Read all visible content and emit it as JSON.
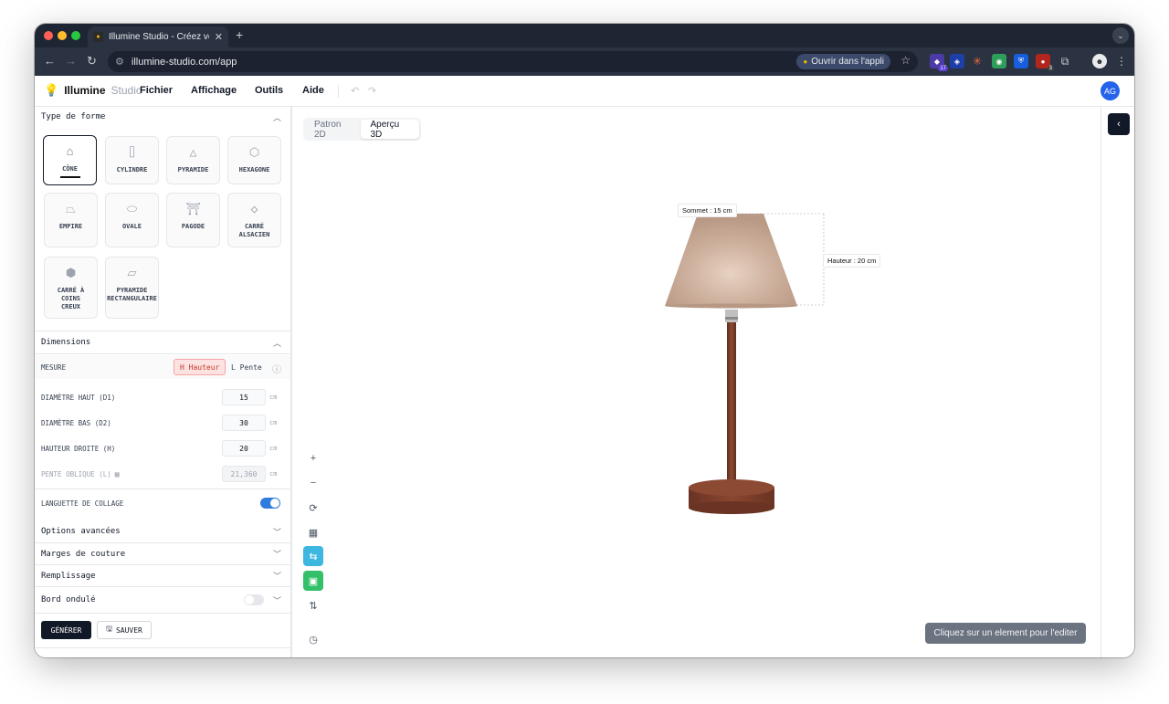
{
  "browser": {
    "tab_title": "Illumine Studio - Créez vos abat-jours",
    "url": "illumine-studio.com/app",
    "open_in_app": "Ouvrir dans l'appli",
    "extension_badges": [
      "17",
      "3"
    ]
  },
  "header": {
    "brand": "Illumine",
    "brand_suffix": "Studio",
    "menus": [
      "Fichier",
      "Affichage",
      "Outils",
      "Aide"
    ],
    "avatar": "AG"
  },
  "shape_section": {
    "title": "Type de forme",
    "shapes": [
      {
        "label": "CÔNE",
        "selected": true
      },
      {
        "label": "CYLINDRE",
        "selected": false
      },
      {
        "label": "PYRAMIDE",
        "selected": false
      },
      {
        "label": "HEXAGONE",
        "selected": false
      },
      {
        "label": "EMPIRE",
        "selected": false
      },
      {
        "label": "OVALE",
        "selected": false
      },
      {
        "label": "PAGODE",
        "selected": false
      },
      {
        "label": "CARRÉ\nALSACIEN",
        "selected": false
      },
      {
        "label": "CARRÉ À\nCOINS\nCREUX",
        "selected": false
      },
      {
        "label": "PYRAMIDE\nRECTANGULAIRE",
        "selected": false
      }
    ]
  },
  "dimensions": {
    "title": "Dimensions",
    "measure_label": "MESURE",
    "measure_options": [
      "H Hauteur",
      "L Pente"
    ],
    "fields": [
      {
        "label": "DIAMÈTRE HAUT (D1)",
        "value": "15",
        "unit": "cm"
      },
      {
        "label": "DIAMÈTRE BAS (D2)",
        "value": "30",
        "unit": "cm"
      },
      {
        "label": "HAUTEUR DROITE (H)",
        "value": "20",
        "unit": "cm"
      },
      {
        "label": "PENTE OBLIQUE (L)",
        "value": "21,360",
        "unit": "cm"
      }
    ],
    "glue_tab_label": "LANGUETTE DE COLLAGE",
    "glue_tab_on": true
  },
  "accordions": [
    "Options avancées",
    "Marges de couture",
    "Remplissage",
    "Bord ondulé"
  ],
  "wavy_edge_on": false,
  "actions": {
    "generate": "GÉNÉRER",
    "save": "SAUVER"
  },
  "viewport": {
    "tabs": [
      "Patron 2D",
      "Aperçu 3D"
    ],
    "active_tab": "Aperçu 3D",
    "top_label": "Sommet : 15 cm",
    "height_label": "Hauteur : 20 cm",
    "hint": "Cliquez sur un element pour l'editer"
  },
  "colors": {
    "shade": "#c8ad9b",
    "wood": "#7a3e2c",
    "accent_blue": "#2f7bde",
    "tool_cyan": "#3db6e0",
    "tool_green": "#34c06a",
    "danger_pink": "#fde2e2"
  }
}
